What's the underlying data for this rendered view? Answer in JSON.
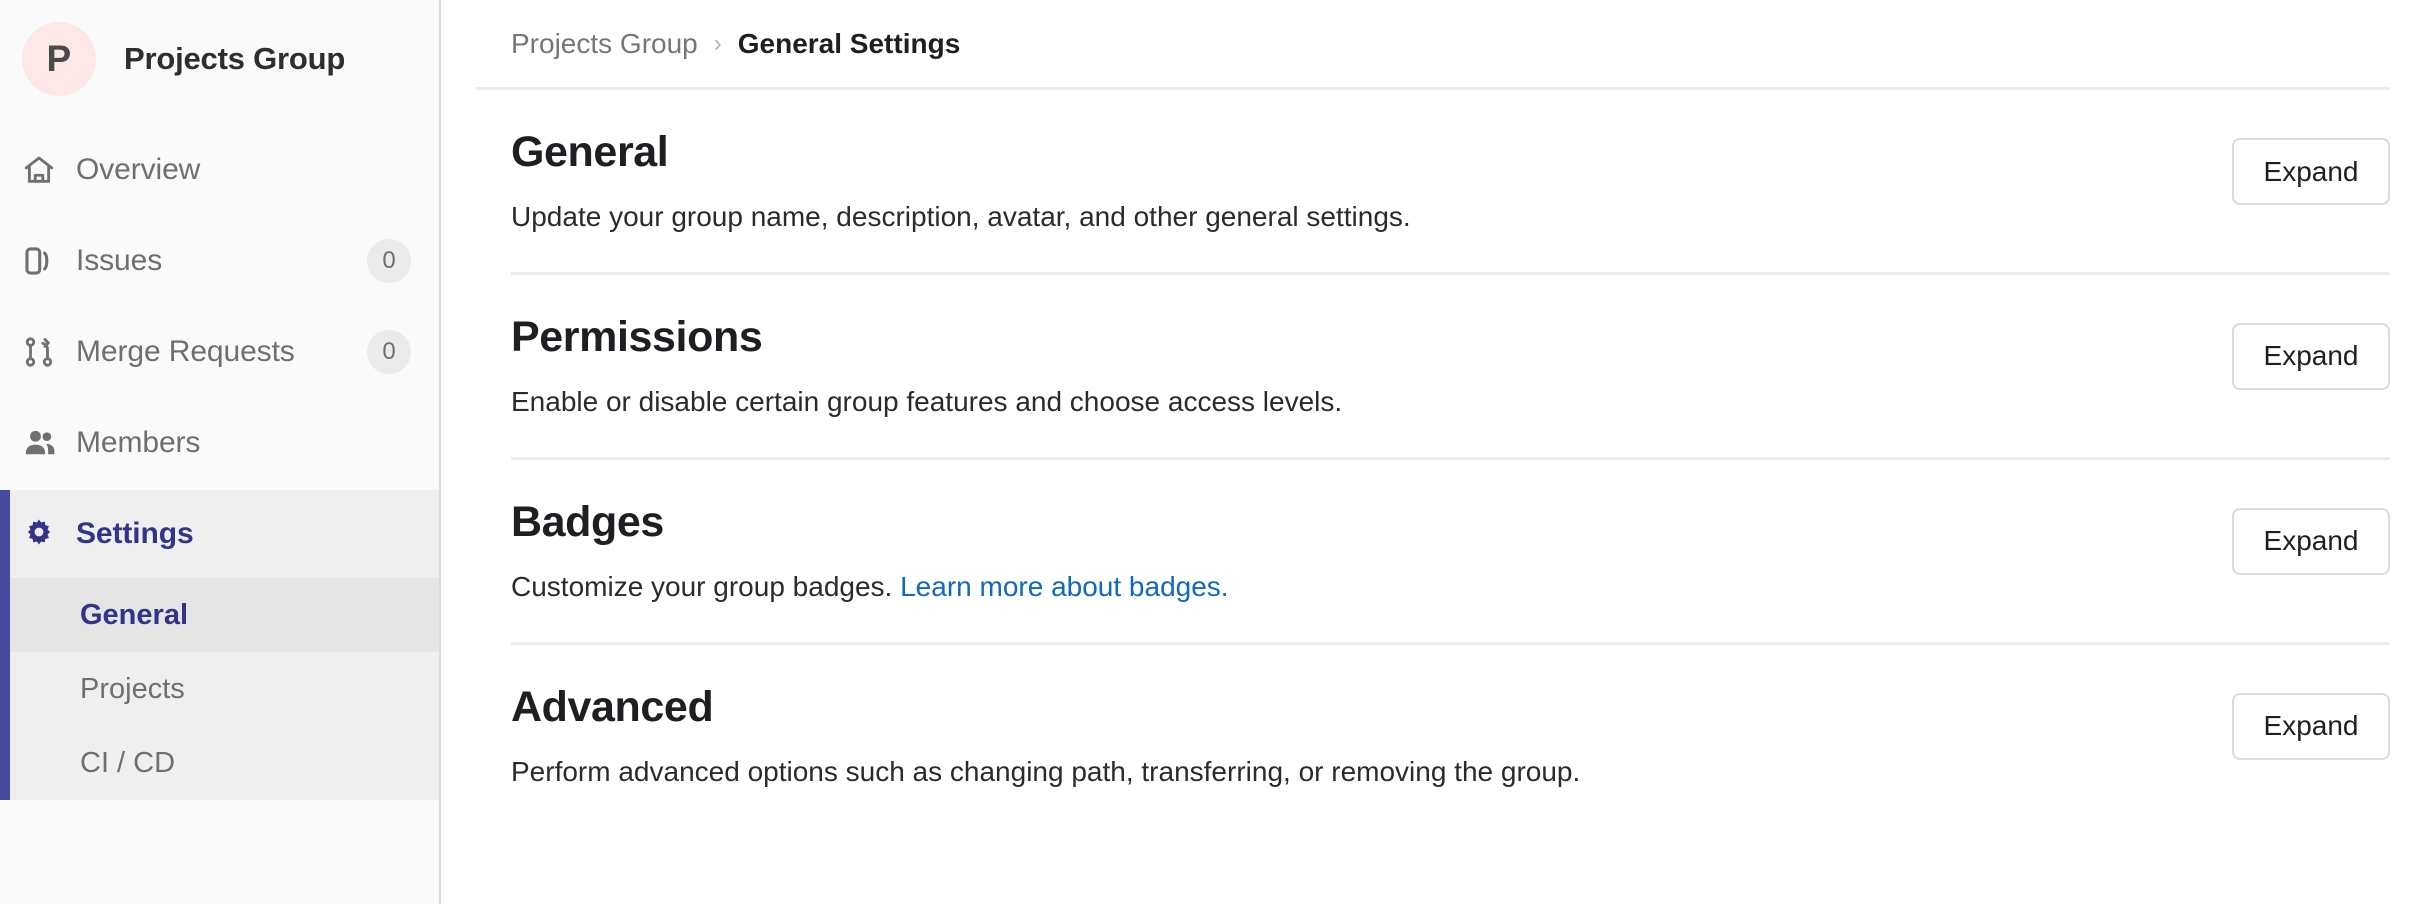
{
  "sidebar": {
    "avatar_letter": "P",
    "group_name": "Projects Group",
    "items": [
      {
        "label": "Overview",
        "icon": "home-icon",
        "count": ""
      },
      {
        "label": "Issues",
        "icon": "issues-icon",
        "count": "0"
      },
      {
        "label": "Merge Requests",
        "icon": "merge-request-icon",
        "count": "0"
      },
      {
        "label": "Members",
        "icon": "members-icon",
        "count": ""
      }
    ],
    "settings": {
      "label": "Settings",
      "icon": "gear-icon",
      "sub_items": [
        {
          "label": "General",
          "active": true
        },
        {
          "label": "Projects",
          "active": false
        },
        {
          "label": "CI / CD",
          "active": false
        }
      ]
    }
  },
  "breadcrumb": {
    "parent": "Projects Group",
    "separator": "›",
    "current": "General Settings"
  },
  "main": {
    "sections": [
      {
        "title": "General",
        "desc": "Update your group name, description, avatar, and other general settings.",
        "link_text": "",
        "button": "Expand"
      },
      {
        "title": "Permissions",
        "desc": "Enable or disable certain group features and choose access levels.",
        "link_text": "",
        "button": "Expand"
      },
      {
        "title": "Badges",
        "desc": "Customize your group badges. ",
        "link_text": "Learn more about badges.",
        "button": "Expand"
      },
      {
        "title": "Advanced",
        "desc": "Perform advanced options such as changing path, transferring, or removing the group.",
        "link_text": "",
        "button": "Expand"
      }
    ]
  },
  "colors": {
    "accent_indigo": "#474aa0",
    "active_text": "#33338a",
    "link_blue": "#1068bf",
    "avatar_bg": "#fde7e7",
    "sidebar_bg": "#fafafa",
    "group_bg": "#efefef",
    "active_bg": "#e5e5e5"
  }
}
